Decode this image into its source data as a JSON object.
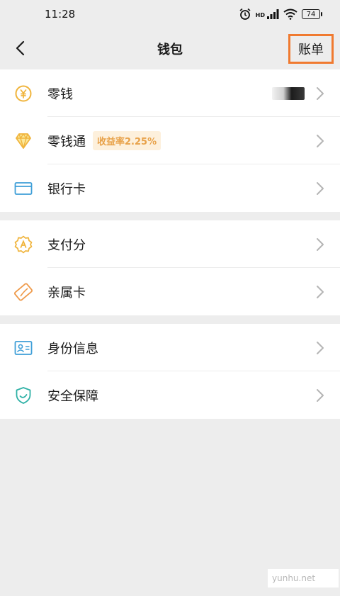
{
  "status_bar": {
    "time": "11:28",
    "battery": "74",
    "hd_label": "HD"
  },
  "nav": {
    "title": "钱包",
    "bill_label": "账单",
    "back_icon": "chevron-left-icon"
  },
  "groups": [
    [
      {
        "label": "零钱",
        "icon": "coin-icon",
        "has_masked_value": true
      },
      {
        "label": "零钱通",
        "icon": "diamond-icon",
        "badge": "收益率2.25%"
      },
      {
        "label": "银行卡",
        "icon": "card-icon"
      }
    ],
    [
      {
        "label": "支付分",
        "icon": "score-badge-icon"
      },
      {
        "label": "亲属卡",
        "icon": "family-card-icon"
      }
    ],
    [
      {
        "label": "身份信息",
        "icon": "id-card-icon"
      },
      {
        "label": "安全保障",
        "icon": "shield-icon"
      }
    ]
  ],
  "watermark": "yunhu.net",
  "colors": {
    "accent_orange": "#f07a30",
    "gold": "#f0b43c",
    "teal": "#2fb1a6",
    "blue": "#3f9fd8"
  }
}
